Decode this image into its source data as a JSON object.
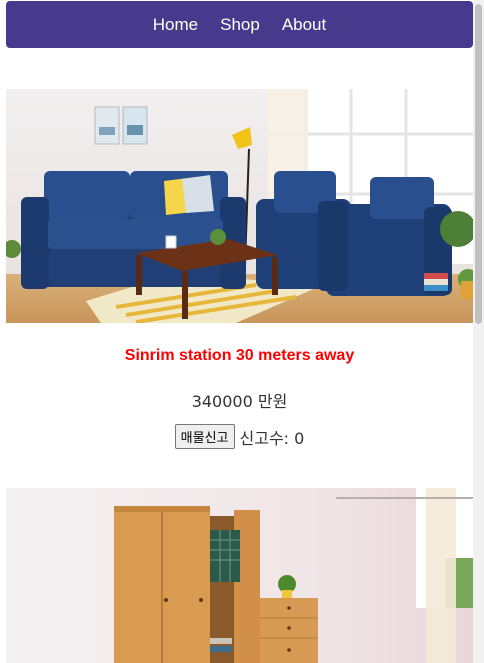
{
  "nav": {
    "items": [
      "Home",
      "Shop",
      "About"
    ]
  },
  "listings": [
    {
      "title": "Sinrim station 30 meters away",
      "price": "340000 만원",
      "report_button_label": "매물신고",
      "report_count_label": "신고수: 0"
    },
    {
      "title": "",
      "price": "",
      "report_button_label": "",
      "report_count_label": ""
    }
  ],
  "colors": {
    "navbar": "#473a8d",
    "title": "#ff0000",
    "text": "#333333"
  }
}
